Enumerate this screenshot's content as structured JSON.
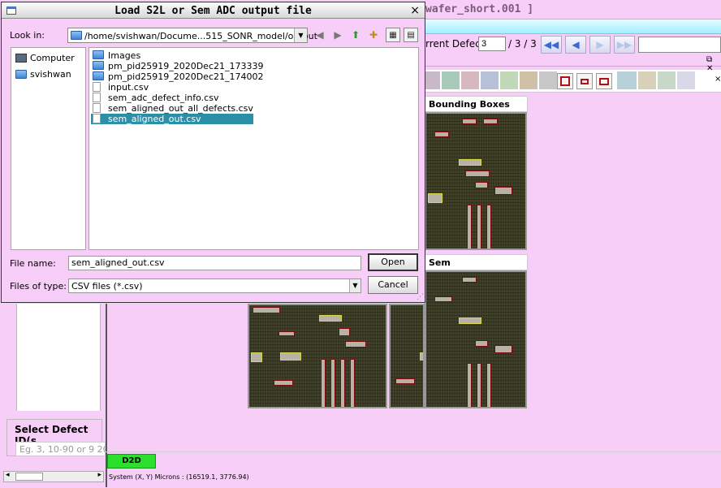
{
  "app": {
    "title_fragment": "wafer_short.001 ]",
    "current_defect_label": "rrent Defect",
    "current_defect_value": "3",
    "defect_count": "/ 3 / 3",
    "nav_first": "◀◀",
    "nav_prev": "◀",
    "nav_next": "▶",
    "nav_last": "▶▶",
    "panel_controls": "⧉ ✕",
    "strip_close": "×",
    "col_bounding_title": "Bounding Boxes",
    "col_sem_title": "Sem",
    "select_defect_legend": "Select Defect ID(s",
    "select_defect_placeholder": "Eg. 3, 10-90 or 9 20",
    "d2d_label": "D2D",
    "status_text": "System (X, Y) Microns : (16519.1, 3776.94)",
    "scroll_left": "◂",
    "scroll_right": "▸"
  },
  "dialog": {
    "title": "Load S2L or Sem ADC output file",
    "close": "×",
    "look_in_label": "Look in:",
    "look_in_path": "/home/svishwan/Docume...515_SONR_model/output",
    "toolbar_icons": [
      "back-icon",
      "forward-icon",
      "up-folder-icon",
      "new-folder-icon",
      "list-view-icon",
      "detail-view-icon"
    ],
    "toolbar_glyphs": [
      "◀",
      "▶",
      "⬆",
      "✚",
      "▦",
      "▤"
    ],
    "places": [
      {
        "label": "Computer",
        "icon": "computer-icon"
      },
      {
        "label": "svishwan",
        "icon": "home-folder-icon"
      }
    ],
    "files": [
      {
        "name": "Images",
        "type": "folder",
        "selected": false
      },
      {
        "name": "pm_pid25919_2020Dec21_173339",
        "type": "folder",
        "selected": false
      },
      {
        "name": "pm_pid25919_2020Dec21_174002",
        "type": "folder",
        "selected": false
      },
      {
        "name": "input.csv",
        "type": "file",
        "selected": false
      },
      {
        "name": "sem_adc_defect_info.csv",
        "type": "file",
        "selected": false
      },
      {
        "name": "sem_aligned_out_all_defects.csv",
        "type": "file",
        "selected": false
      },
      {
        "name": "sem_aligned_out.csv",
        "type": "file",
        "selected": true
      }
    ],
    "file_name_label": "File name:",
    "file_name_value": "sem_aligned_out.csv",
    "file_type_label": "Files of type:",
    "file_type_value": "CSV files (*.csv)",
    "open_label": "Open",
    "cancel_label": "Cancel"
  }
}
